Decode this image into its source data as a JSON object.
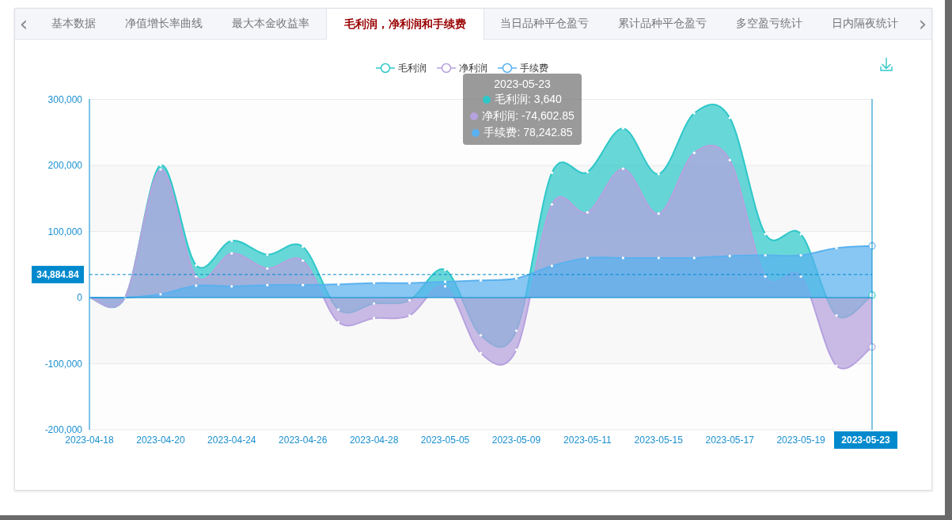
{
  "tabs": [
    {
      "label": "基本数据",
      "selected": false
    },
    {
      "label": "净值增长率曲线",
      "selected": false
    },
    {
      "label": "最大本金收益率",
      "selected": false
    },
    {
      "label": "毛利润，净利润和手续费",
      "selected": true
    },
    {
      "label": "当日品种平仓盈亏",
      "selected": false
    },
    {
      "label": "累计品种平仓盈亏",
      "selected": false
    },
    {
      "label": "多空盈亏统计",
      "selected": false
    },
    {
      "label": "日内隔夜统计",
      "selected": false
    }
  ],
  "tab_scroll": {
    "prev": "‹",
    "next": "›"
  },
  "chart": {
    "chart_data": {
      "type": "area",
      "categories": [
        "2023-04-18",
        null,
        "2023-04-20",
        null,
        "2023-04-24",
        null,
        "2023-04-26",
        null,
        "2023-04-28",
        null,
        "2023-05-05",
        null,
        "2023-05-09",
        null,
        "2023-05-11",
        null,
        "2023-05-15",
        null,
        "2023-05-17",
        null,
        "2023-05-19",
        null,
        "2023-05-23"
      ],
      "series": [
        {
          "name": "毛利润",
          "color": "#2ec7c9",
          "values": [
            0,
            0,
            200000,
            49000,
            86000,
            65000,
            77000,
            -18000,
            -9000,
            -4000,
            42000,
            -57000,
            -50000,
            189000,
            190000,
            256000,
            187000,
            279000,
            272000,
            96000,
            96000,
            -27000,
            3640
          ]
        },
        {
          "name": "净利润",
          "color": "#b6a2de",
          "values": [
            0,
            0,
            194000,
            32000,
            67000,
            44000,
            56000,
            -37000,
            -31000,
            -27000,
            17000,
            -84000,
            -79000,
            141000,
            129000,
            195000,
            127000,
            219000,
            208000,
            32000,
            32000,
            -103000,
            -74602.85
          ]
        },
        {
          "name": "手续费",
          "color": "#5ab1ef",
          "values": [
            0,
            0,
            5000,
            18000,
            17000,
            19000,
            19000,
            20000,
            22000,
            22000,
            24000,
            26000,
            29000,
            48000,
            60000,
            60000,
            60000,
            60000,
            63000,
            64000,
            64000,
            75000,
            78242.85
          ]
        }
      ],
      "ylim": [
        -200000,
        300000
      ],
      "yticks": [
        {
          "value": 300000,
          "label": "300,000"
        },
        {
          "value": 200000,
          "label": "200,000"
        },
        {
          "value": 100000,
          "label": "100,000"
        },
        {
          "value": 0,
          "label": "0"
        },
        {
          "value": -100000,
          "label": "-100,000"
        },
        {
          "value": -200000,
          "label": "-200,000"
        }
      ],
      "ref_lines": [
        {
          "axis": "y",
          "value": 34884.84,
          "label": "34,884.84"
        }
      ],
      "grid": true,
      "legend": "top"
    },
    "axis_pointer": {
      "on": true
    },
    "tooltip": {
      "title": "2023-05-23",
      "rows": [
        {
          "label": "毛利润: 3,640",
          "color": "#2ec7c9"
        },
        {
          "label": "净利润: -74,602.85",
          "color": "#b6a2de"
        },
        {
          "label": "手续费: 78,242.85",
          "color": "#5ab1ef"
        }
      ]
    }
  }
}
